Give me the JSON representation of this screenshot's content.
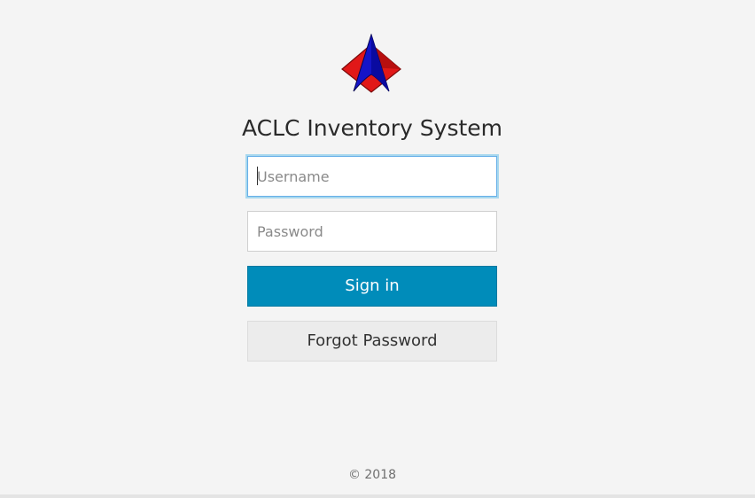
{
  "app": {
    "title": "ACLC Inventory System"
  },
  "login_form": {
    "username_placeholder": "Username",
    "password_placeholder": "Password",
    "signin_label": "Sign in",
    "forgot_label": "Forgot Password"
  },
  "footer": {
    "copyright": "© 2018"
  },
  "colors": {
    "background": "#f4f4f4",
    "primary_button": "#008cba",
    "secondary_button": "#ececec",
    "logo_blue": "#1414c8",
    "logo_red": "#e11818"
  },
  "icons": {
    "logo": "aclc-logo-icon"
  }
}
